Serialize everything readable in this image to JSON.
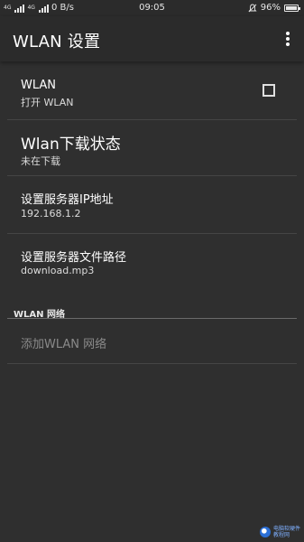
{
  "status_bar": {
    "network_tiny_1": "4G",
    "network_tiny_2": "4G",
    "speed": "0 B/s",
    "time": "09:05",
    "battery": "96%",
    "battery_level": 0.96
  },
  "app_bar": {
    "title": "WLAN 设置"
  },
  "preferences": {
    "wlan": {
      "title": "WLAN",
      "summary": "打开 WLAN",
      "checked": false
    },
    "download_status": {
      "title": "Wlan下载状态",
      "summary": "未在下载"
    },
    "server_ip": {
      "title": "设置服务器IP地址",
      "summary": "192.168.1.2"
    },
    "server_path": {
      "title": "设置服务器文件路径",
      "summary": "download.mp3"
    }
  },
  "category": {
    "title": "WLAN 网络",
    "add_network": "添加WLAN 网络"
  },
  "watermark": {
    "line1": "电脑软硬件",
    "line2": "教程网"
  },
  "colors": {
    "background": "#2f2f2f",
    "app_bar": "#2b2b2b",
    "divider": "#454545",
    "disabled_text": "#8a8a8a"
  }
}
